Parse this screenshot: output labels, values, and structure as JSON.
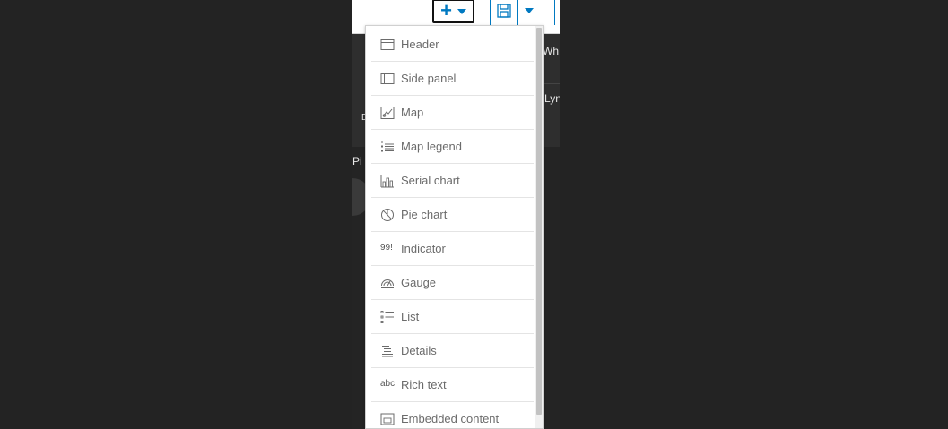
{
  "toolbar": {
    "add_label": "+",
    "add_caret": "chevron-down-icon",
    "save_icon": "save-icon",
    "save_caret": "chevron-down-icon",
    "accent": "#0079c1"
  },
  "map": {
    "labels": [
      "Wh",
      "Lyn",
      "Pi"
    ]
  },
  "menu": {
    "items": [
      {
        "label": "Header",
        "icon": "header-icon"
      },
      {
        "label": "Side panel",
        "icon": "side-panel-icon"
      },
      {
        "label": "Map",
        "icon": "map-icon"
      },
      {
        "label": "Map legend",
        "icon": "map-legend-icon"
      },
      {
        "label": "Serial chart",
        "icon": "serial-chart-icon"
      },
      {
        "label": "Pie chart",
        "icon": "pie-chart-icon"
      },
      {
        "label": "Indicator",
        "icon": "indicator-icon",
        "icon_text": "99!"
      },
      {
        "label": "Gauge",
        "icon": "gauge-icon"
      },
      {
        "label": "List",
        "icon": "list-icon"
      },
      {
        "label": "Details",
        "icon": "details-icon"
      },
      {
        "label": "Rich text",
        "icon": "rich-text-icon",
        "icon_text": "abc"
      },
      {
        "label": "Embedded content",
        "icon": "embedded-content-icon"
      }
    ]
  }
}
